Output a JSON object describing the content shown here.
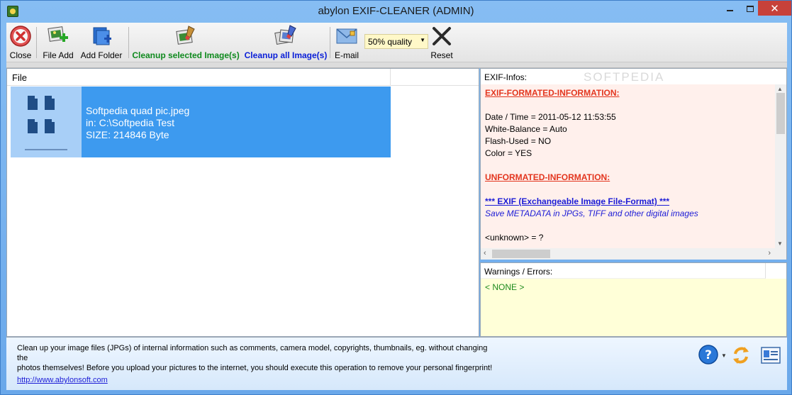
{
  "window": {
    "title": "abylon EXIF-CLEANER (ADMIN)"
  },
  "toolbar": {
    "close": "Close",
    "file_add": "File Add",
    "add_folder": "Add Folder",
    "cleanup_selected": "Cleanup selected Image(s)",
    "cleanup_all": "Cleanup all Image(s)",
    "email": "E-mail",
    "quality": "50% quality",
    "reset": "Reset"
  },
  "file_list": {
    "column_header": "File",
    "items": [
      {
        "name": "Softpedia quad pic.jpeg",
        "path": "in: C:\\Softpedia Test",
        "size": "SIZE: 214846 Byte"
      }
    ]
  },
  "exif": {
    "header": "EXIF-Infos:",
    "watermark": "SOFTPEDIA",
    "formatted_title": "EXIF-FORMATED-INFORMATION:",
    "lines": [
      "Date / Time = 2011-05-12 11:53:55",
      "White-Balance = Auto",
      "Flash-Used = NO",
      "Color = YES"
    ],
    "unformatted_title": "UNFORMATED-INFORMATION:",
    "exif_link": "*** EXIF (Exchangeable Image File-Format) ***",
    "exif_desc": "Save METADATA in JPGs, TIFF and other digital images",
    "unknown": "<unknown> = ?"
  },
  "warnings": {
    "header": "Warnings / Errors:",
    "value": "< NONE >"
  },
  "footer": {
    "description_1": "Clean up your image files (JPGs) of internal information such as comments, camera model, copyrights, thumbnails, eg.  without changing the",
    "description_2": "photos themselves! Before you upload your pictures to the internet, you should execute this operation to remove your personal fingerprint!",
    "link": "http://www.abylonsoft.com"
  },
  "colors": {
    "selection": "#3d9aef",
    "exif_bg": "#fff0ec",
    "warn_bg": "#ffffd8",
    "section_red": "#e3361f",
    "link_blue": "#1c1cd6"
  }
}
